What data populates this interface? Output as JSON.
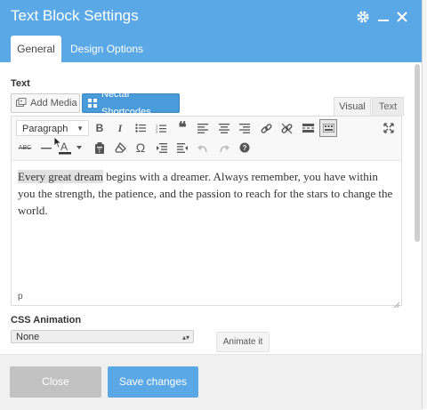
{
  "dialog": {
    "title": "Text Block Settings",
    "icons": [
      "gear-icon",
      "minimize-icon",
      "close-icon"
    ]
  },
  "tabs": [
    {
      "label": "General",
      "active": true
    },
    {
      "label": "Design Options",
      "active": false
    }
  ],
  "text_section": {
    "label": "Text",
    "add_media_label": "Add Media",
    "nectar_label": "Nectar Shortcodes",
    "visual_tab": "Visual",
    "text_tab": "Text"
  },
  "toolbar": {
    "format_select": "Paragraph",
    "row1_icons": [
      "bold-icon",
      "italic-icon",
      "bullet-list-icon",
      "numbered-list-icon",
      "blockquote-icon",
      "align-left-icon",
      "align-center-icon",
      "align-right-icon",
      "link-icon",
      "unlink-icon",
      "read-more-icon",
      "toolbar-toggle-icon",
      "fullscreen-icon"
    ],
    "row2_icons": [
      "strikethrough-icon",
      "horizontal-line-icon",
      "text-color-icon",
      "paste-text-icon",
      "clear-formatting-icon",
      "special-character-icon",
      "outdent-icon",
      "indent-icon",
      "undo-icon",
      "redo-icon",
      "help-icon"
    ]
  },
  "editor": {
    "highlighted": "Every great dream",
    "body": " begins with a dreamer. Always remember, you have within you the strength, the patience, and the passion to reach for the stars to change the world.",
    "status_path": "p"
  },
  "animation": {
    "label": "CSS Animation",
    "selected": "None",
    "animate_button": "Animate it"
  },
  "footer": {
    "close_label": "Close",
    "save_label": "Save changes"
  },
  "colors": {
    "header": "#5aa8e6",
    "nectar_button": "#4a9bd9",
    "save_button": "#5aa8e6",
    "close_button": "#c2c2c2"
  }
}
